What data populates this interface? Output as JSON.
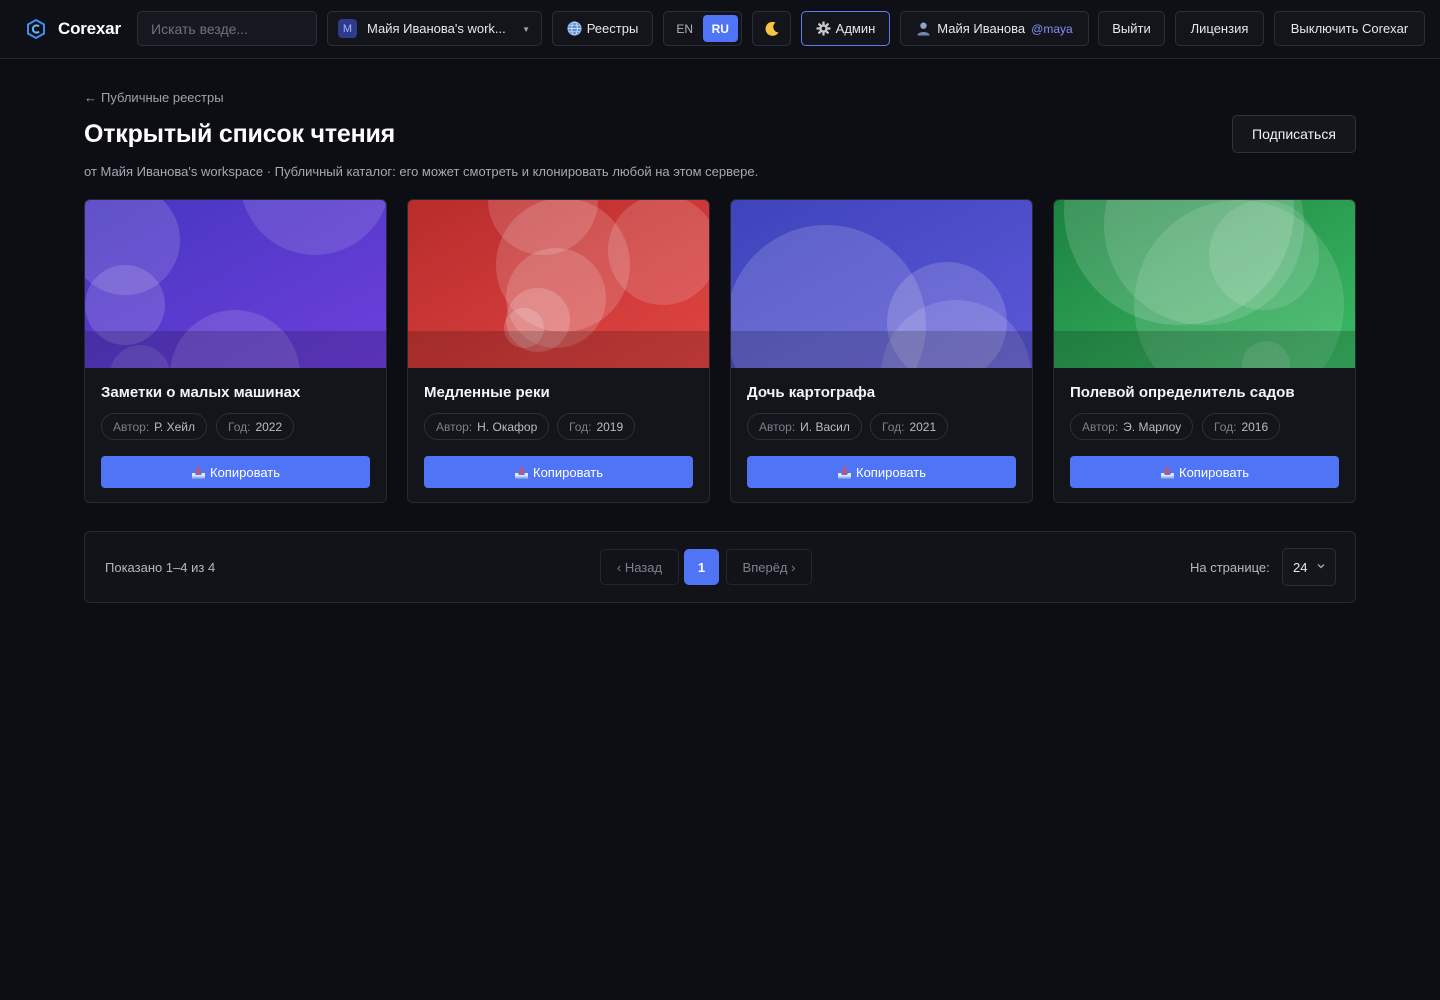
{
  "brand": {
    "name": "Corexar"
  },
  "topbar": {
    "search_placeholder": "Искать везде...",
    "workspace_badge": "M",
    "workspace_label": "Майя Иванова's work...",
    "registries_label": "Реестры",
    "lang_en": "EN",
    "lang_ru": "RU",
    "theme_icon": "moon-icon",
    "admin_label": "Админ",
    "user_name": "Майя Иванова",
    "user_handle": "@maya",
    "logout_label": "Выйти",
    "license_label": "Лицензия",
    "disable_label": "Выключить Corexar"
  },
  "header": {
    "back_label": "Публичные реестры",
    "title": "Открытый список чтения",
    "subscribe_label": "Подписаться",
    "subtitle": "от Майя Иванова's workspace · Публичный каталог: его может смотреть и клонировать любой на этом сервере."
  },
  "card_labels": {
    "author_key": "Автор:",
    "year_key": "Год:",
    "copy_label": "Копировать"
  },
  "cards": [
    {
      "title": "Заметки о малых машинах",
      "author": "Р. Хейл",
      "year": "2022",
      "cover_colors": [
        "#4a3bc4",
        "#6c3fd9"
      ]
    },
    {
      "title": "Медленные реки",
      "author": "Н. Окафор",
      "year": "2019",
      "cover_colors": [
        "#c0302f",
        "#dc4540"
      ]
    },
    {
      "title": "Дочь картографа",
      "author": "И. Васил",
      "year": "2021",
      "cover_colors": [
        "#4348c0",
        "#5a55d6"
      ]
    },
    {
      "title": "Полевой определитель садов",
      "author": "Э. Марлоу",
      "year": "2016",
      "cover_colors": [
        "#1f8a42",
        "#38b862"
      ]
    }
  ],
  "pagination": {
    "shown": "Показано 1–4 из 4",
    "prev_label": "‹ Назад",
    "current_page": "1",
    "next_label": "Вперёд ›",
    "per_page_label": "На странице:",
    "per_page_value": "24"
  },
  "colors": {
    "accent": "#4f74f5",
    "background": "#0d0e13",
    "surface": "#14151b"
  }
}
